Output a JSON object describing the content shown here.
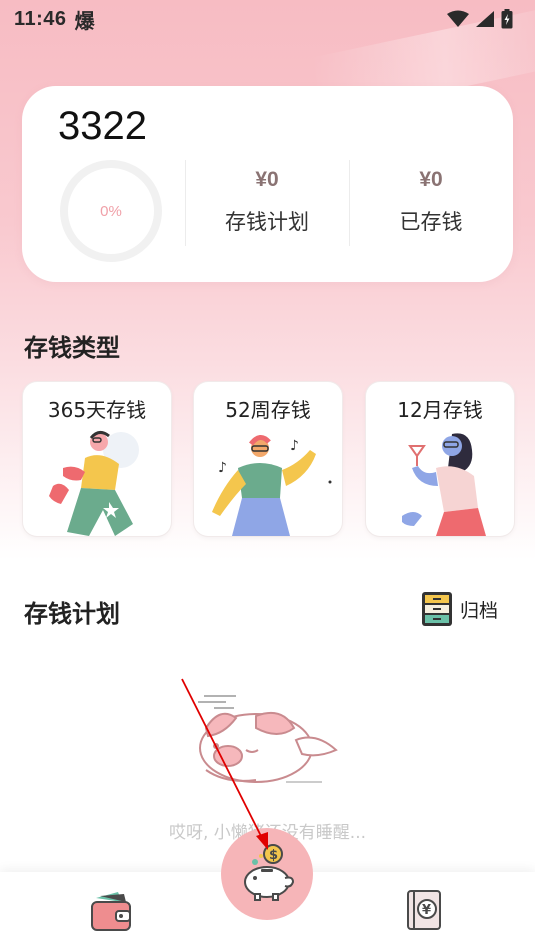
{
  "status_bar": {
    "time": "11:46",
    "notification_glyph": "爆"
  },
  "summary": {
    "title": "3322",
    "progress_text": "0%",
    "progress_fraction": 0,
    "plan_amount": "¥0",
    "plan_label": "存钱计划",
    "saved_amount": "¥0",
    "saved_label": "已存钱"
  },
  "types_section": {
    "title": "存钱类型",
    "cards": [
      {
        "label": "365天存钱"
      },
      {
        "label": "52周存钱"
      },
      {
        "label": "12月存钱"
      }
    ]
  },
  "plan_section": {
    "title": "存钱计划",
    "archive_label": "归档",
    "empty_text": "哎呀, 小懒猪还没有睡醒..."
  },
  "bottom_nav": {
    "left_icon": "wallet-icon",
    "center_icon": "piggy-bank-icon",
    "right_icon": "ledger-book-icon"
  },
  "colors": {
    "accent_pink": "#f6b5b8",
    "amount_brown": "#8a7373",
    "annotation_red": "#e00000"
  }
}
